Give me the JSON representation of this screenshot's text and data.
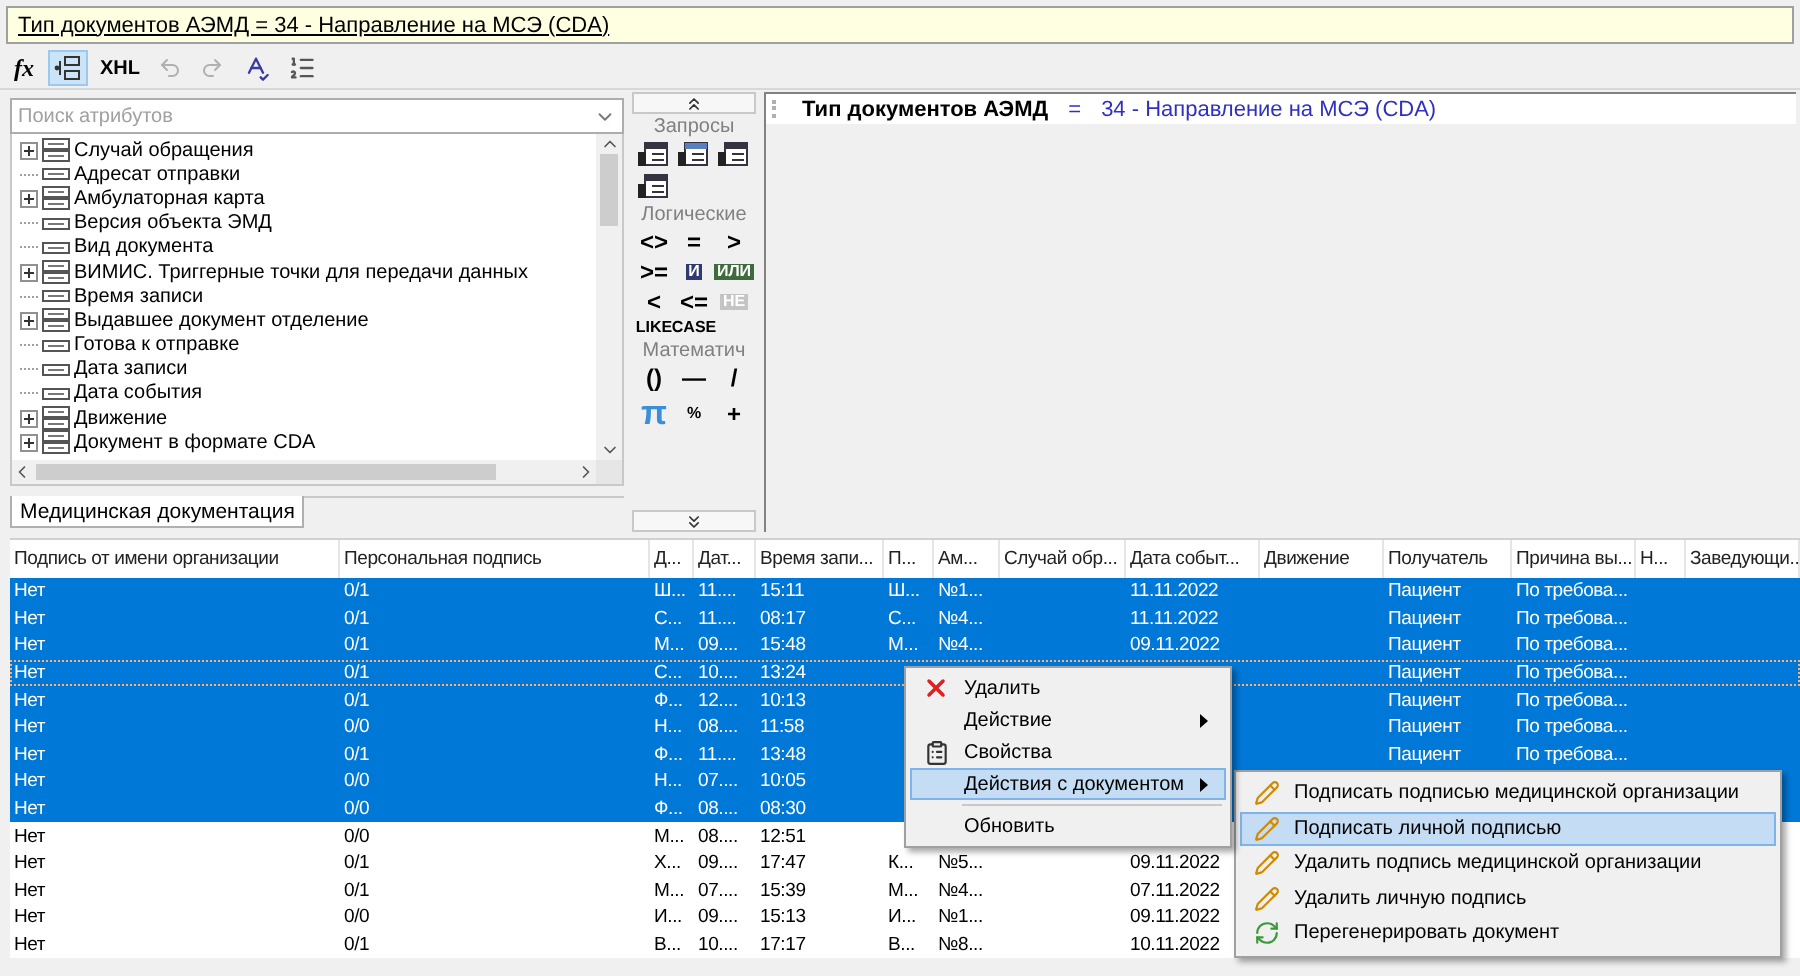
{
  "condition_bar": {
    "text": "Тип документов АЭМД = 34 - Направление на МСЭ (CDA)"
  },
  "toolbar": {
    "fx_label": "fx",
    "structure_selected": true,
    "xhl_label": "XHL",
    "undo_disabled": true,
    "redo_disabled": true
  },
  "attribute_panel": {
    "search": {
      "placeholder": "Поиск атрибутов"
    },
    "tree": [
      {
        "label": "Случай обращения",
        "kind": "group",
        "expanded": false
      },
      {
        "label": "Адресат отправки",
        "kind": "leaf"
      },
      {
        "label": "Амбулаторная карта",
        "kind": "group",
        "expanded": false
      },
      {
        "label": "Версия объекта ЭМД",
        "kind": "leaf"
      },
      {
        "label": "Вид документа",
        "kind": "leaf"
      },
      {
        "label": "ВИМИС. Триггерные точки для передачи данных",
        "kind": "group",
        "expanded": false
      },
      {
        "label": "Время записи",
        "kind": "leaf"
      },
      {
        "label": "Выдавшее документ отделение",
        "kind": "group",
        "expanded": false
      },
      {
        "label": "Готова к отправке",
        "kind": "leaf"
      },
      {
        "label": "Дата записи",
        "kind": "leaf"
      },
      {
        "label": "Дата события",
        "kind": "leaf"
      },
      {
        "label": "Движение",
        "kind": "group",
        "expanded": false
      },
      {
        "label": "Документ в формате CDA",
        "kind": "group",
        "expanded": false
      }
    ],
    "tab": {
      "label": "Медицинская документация",
      "selected": true
    }
  },
  "palette": {
    "sections": [
      {
        "title": "Запросы",
        "kind": "queries"
      },
      {
        "title": "Логические",
        "kind": "operators",
        "items": [
          {
            "label": "<>",
            "kind": "text",
            "color": "#000000"
          },
          {
            "label": "=",
            "kind": "text",
            "color": "#000000"
          },
          {
            "label": ">",
            "kind": "text",
            "color": "#000000"
          },
          {
            "label": ">=",
            "kind": "text",
            "color": "#000000"
          },
          {
            "label": "И",
            "kind": "badge",
            "color": "#2f3a6e"
          },
          {
            "label": "ИЛИ",
            "kind": "badge",
            "color": "#3d6b3d"
          },
          {
            "label": "<",
            "kind": "text",
            "color": "#000000"
          },
          {
            "label": "<=",
            "kind": "text",
            "color": "#000000"
          },
          {
            "label": "НЕ",
            "kind": "badge",
            "color": "#c4c4c4"
          },
          {
            "label": "LIKE",
            "kind": "small",
            "color": "#000000"
          },
          {
            "label": "CASE",
            "kind": "small",
            "color": "#000000"
          }
        ]
      },
      {
        "title": "Математич",
        "kind": "operators",
        "items": [
          {
            "label": "()",
            "kind": "text",
            "color": "#000000"
          },
          {
            "label": "—",
            "kind": "text",
            "color": "#000000"
          },
          {
            "label": "/",
            "kind": "text",
            "color": "#000000"
          },
          {
            "label": "π",
            "kind": "large",
            "color": "#3a8fd8"
          },
          {
            "label": "%",
            "kind": "small",
            "color": "#000000"
          },
          {
            "label": "+",
            "kind": "text",
            "color": "#000000"
          }
        ]
      }
    ]
  },
  "conditions": [
    {
      "field": "Тип документов АЭМД",
      "operator": "=",
      "value": "34 - Направление на МСЭ (CDA)"
    }
  ],
  "table": {
    "columns": [
      "Подпись от имени организации",
      "Персональная подпись",
      "Д...",
      "Дат...",
      "Время запи...",
      "П...",
      "Ам...",
      "Случай обр...",
      "Дата событ...",
      "Движение",
      "Получатель",
      "Причина вы...",
      "Н...",
      "Заведующи..."
    ],
    "rows": [
      {
        "selected": true,
        "focused": false,
        "cells": [
          "Нет",
          "0/1",
          "Ш...",
          "11....",
          "15:11",
          "Ш...",
          "№1...",
          null,
          "11.11.2022",
          null,
          "Пациент",
          "По требова...",
          null,
          null
        ]
      },
      {
        "selected": true,
        "focused": false,
        "cells": [
          "Нет",
          "0/1",
          "С...",
          "11....",
          "08:17",
          "С...",
          "№4...",
          null,
          "11.11.2022",
          null,
          "Пациент",
          "По требова...",
          null,
          null
        ]
      },
      {
        "selected": true,
        "focused": false,
        "cells": [
          "Нет",
          "0/1",
          "М...",
          "09....",
          "15:48",
          "М...",
          "№4...",
          null,
          "09.11.2022",
          null,
          "Пациент",
          "По требова...",
          null,
          null
        ]
      },
      {
        "selected": true,
        "focused": true,
        "cells": [
          "Нет",
          "0/1",
          "С...",
          "10....",
          "13:24",
          null,
          null,
          null,
          null,
          null,
          "Пациент",
          "По требова...",
          null,
          null
        ]
      },
      {
        "selected": true,
        "focused": false,
        "cells": [
          "Нет",
          "0/1",
          "Ф...",
          "12....",
          "10:13",
          null,
          null,
          null,
          null,
          null,
          "Пациент",
          "По требова...",
          null,
          null
        ]
      },
      {
        "selected": true,
        "focused": false,
        "cells": [
          "Нет",
          "0/0",
          "Н...",
          "08....",
          "11:58",
          null,
          null,
          null,
          null,
          null,
          "Пациент",
          "По требова...",
          null,
          null
        ]
      },
      {
        "selected": true,
        "focused": false,
        "cells": [
          "Нет",
          "0/1",
          "Ф...",
          "11....",
          "13:48",
          null,
          null,
          null,
          null,
          null,
          "Пациент",
          "По требова...",
          null,
          null
        ]
      },
      {
        "selected": true,
        "focused": false,
        "cells": [
          "Нет",
          "0/0",
          "Н...",
          "07....",
          "10:05",
          null,
          null,
          null,
          null,
          null,
          null,
          null,
          null,
          null
        ]
      },
      {
        "selected": true,
        "focused": false,
        "cells": [
          "Нет",
          "0/0",
          "Ф...",
          "08....",
          "08:30",
          null,
          null,
          null,
          null,
          null,
          null,
          null,
          null,
          null
        ]
      },
      {
        "selected": false,
        "focused": false,
        "cells": [
          "Нет",
          "0/0",
          "М...",
          "08....",
          "12:51",
          null,
          null,
          null,
          null,
          null,
          null,
          null,
          null,
          null
        ]
      },
      {
        "selected": false,
        "focused": false,
        "cells": [
          "Нет",
          "0/1",
          "Х...",
          "09....",
          "17:47",
          "К...",
          "№5...",
          null,
          "09.11.2022",
          null,
          null,
          null,
          null,
          null
        ]
      },
      {
        "selected": false,
        "focused": false,
        "cells": [
          "Нет",
          "0/1",
          "М...",
          "07....",
          "15:39",
          "М...",
          "№4...",
          null,
          "07.11.2022",
          null,
          null,
          null,
          null,
          null
        ]
      },
      {
        "selected": false,
        "focused": false,
        "cells": [
          "Нет",
          "0/0",
          "И...",
          "09....",
          "15:13",
          "И...",
          "№1...",
          null,
          "09.11.2022",
          null,
          null,
          null,
          null,
          null
        ]
      },
      {
        "selected": false,
        "focused": false,
        "cells": [
          "Нет",
          "0/1",
          "В...",
          "10....",
          "17:17",
          "В...",
          "№8...",
          null,
          "10.11.2022",
          null,
          null,
          null,
          null,
          null
        ]
      }
    ]
  },
  "context_menu": {
    "items": [
      {
        "kind": "item",
        "label": "Удалить",
        "submenu": false,
        "selected": false
      },
      {
        "kind": "item",
        "label": "Действие",
        "submenu": true,
        "selected": false
      },
      {
        "kind": "item",
        "label": "Свойства",
        "submenu": false,
        "selected": false
      },
      {
        "kind": "item",
        "label": "Действия с документом",
        "submenu": true,
        "selected": true
      },
      {
        "kind": "separator"
      },
      {
        "kind": "item",
        "label": "Обновить",
        "submenu": false,
        "selected": false
      }
    ]
  },
  "submenu": {
    "items": [
      {
        "label": "Подписать подписью медицинской организации",
        "selected": false
      },
      {
        "label": "Подписать личной подписью",
        "selected": true
      },
      {
        "label": "Удалить подпись медицинской организации",
        "selected": false
      },
      {
        "label": "Удалить личную подпись",
        "selected": false
      },
      {
        "label": "Перегенерировать документ",
        "selected": false
      }
    ]
  }
}
